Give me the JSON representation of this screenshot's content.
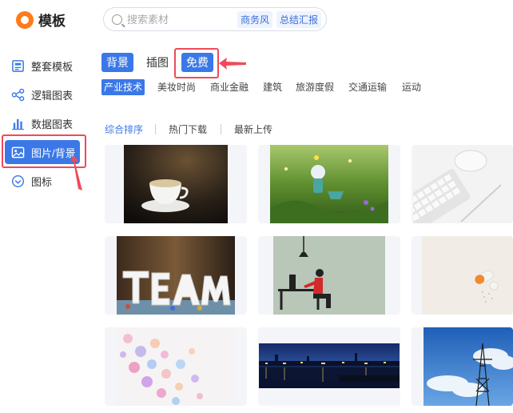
{
  "header": {
    "logo_text": "模板",
    "search_placeholder": "搜索素材",
    "search_tags": [
      "商务风",
      "总结汇报"
    ]
  },
  "sidebar": {
    "items": [
      {
        "label": "整套模板",
        "icon": "template-icon"
      },
      {
        "label": "逻辑图表",
        "icon": "logic-chart-icon"
      },
      {
        "label": "数据图表",
        "icon": "bar-chart-icon"
      },
      {
        "label": "图片/背景",
        "icon": "image-icon",
        "active": true
      },
      {
        "label": "图标",
        "icon": "heart-badge-icon"
      }
    ]
  },
  "tabs": [
    {
      "label": "背景",
      "active": true
    },
    {
      "label": "插图",
      "active": false
    },
    {
      "label": "免费",
      "active": true
    }
  ],
  "categories": [
    {
      "label": "产业技术",
      "active": true
    },
    {
      "label": "美妆时尚"
    },
    {
      "label": "商业金融"
    },
    {
      "label": "建筑"
    },
    {
      "label": "旅游度假"
    },
    {
      "label": "交通运输"
    },
    {
      "label": "运动"
    }
  ],
  "sort": [
    {
      "label": "综合排序",
      "active": true
    },
    {
      "label": "热门下载"
    },
    {
      "label": "最新上传"
    }
  ],
  "images": [
    {
      "name": "coffee-cup-image"
    },
    {
      "name": "grass-toy-image"
    },
    {
      "name": "keyboard-mouse-image"
    },
    {
      "name": "team-letters-image"
    },
    {
      "name": "desk-worker-illustration"
    },
    {
      "name": "pills-image"
    },
    {
      "name": "watercolor-dots-image"
    },
    {
      "name": "city-night-skyline-image"
    },
    {
      "name": "power-tower-sky-image"
    }
  ],
  "colors": {
    "accent": "#3b78e7",
    "annotation": "#f04a5a",
    "logo": "#ff7a1a"
  }
}
